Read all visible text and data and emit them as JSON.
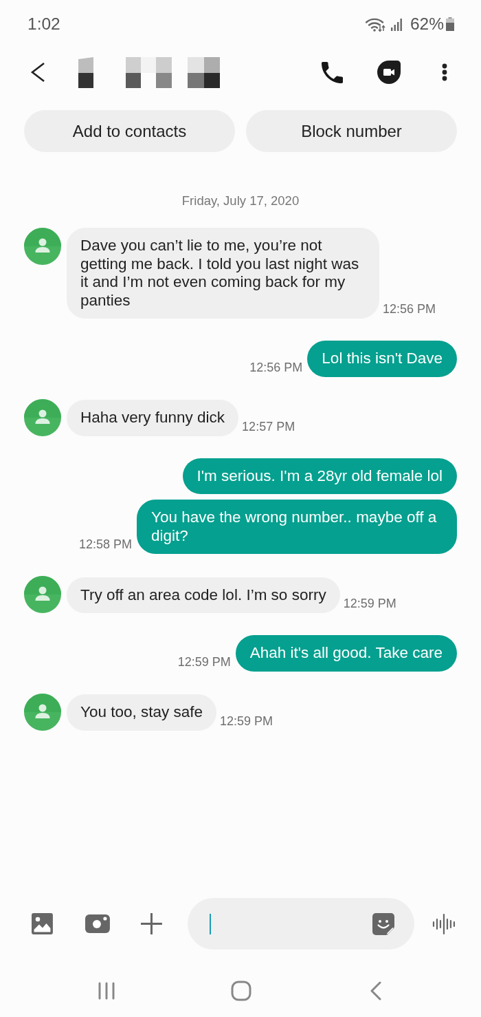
{
  "status_bar": {
    "time": "1:02",
    "battery": "62%"
  },
  "actions": [
    {
      "label": "Add to contacts"
    },
    {
      "label": "Block number"
    }
  ],
  "date_divider": "Friday, July 17, 2020",
  "messages": [
    {
      "kind": "incoming",
      "text": "Dave you can’t lie to me, you’re not getting me back. I told you last night was it and I’m not even coming back for my panties",
      "time": "12:56 PM"
    },
    {
      "kind": "outgoing",
      "text": "Lol this isn't Dave",
      "time": "12:56 PM"
    },
    {
      "kind": "incoming",
      "text": "Haha very funny dick",
      "time": "12:57 PM"
    },
    {
      "kind": "outgoing",
      "text": "I'm serious. I'm a 28yr old female lol"
    },
    {
      "kind": "outgoing",
      "text": "You have the wrong number.. maybe off a digit?",
      "time": "12:58 PM"
    },
    {
      "kind": "incoming",
      "text": "Try off an area code lol. I’m so sorry",
      "time": "12:59 PM"
    },
    {
      "kind": "outgoing",
      "text": "Ahah it's all good. Take care",
      "time": "12:59 PM"
    },
    {
      "kind": "incoming",
      "text": "You too, stay safe",
      "time": "12:59 PM"
    }
  ]
}
